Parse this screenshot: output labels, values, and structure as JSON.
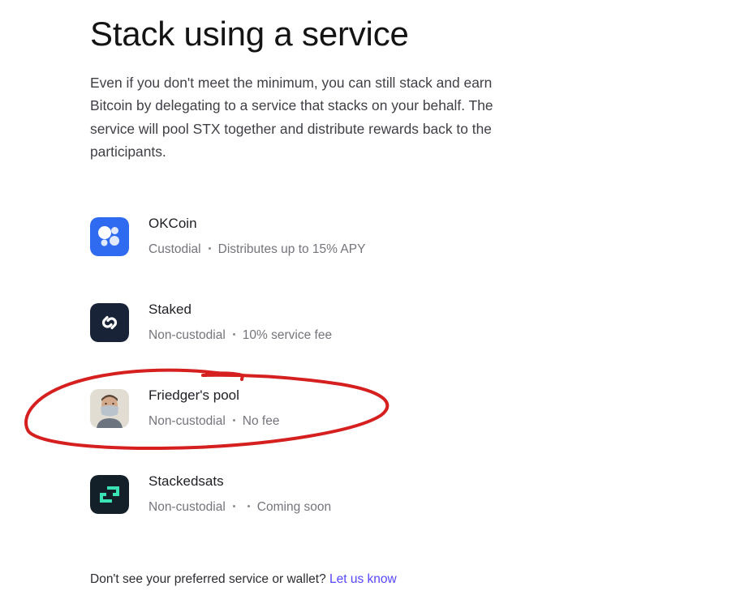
{
  "page": {
    "title": "Stack using a service",
    "description": "Even if you don't meet the minimum, you can still stack and earn Bitcoin by delegating to a service that stacks on your behalf. The service will pool STX together and distribute rewards back to the participants."
  },
  "services": [
    {
      "name": "OKCoin",
      "icon": "okcoin-logo",
      "custody": "Custodial",
      "detail": "Distributes up to 15% APY",
      "accent": "#2f6bf1"
    },
    {
      "name": "Staked",
      "icon": "staked-logo",
      "custody": "Non-custodial",
      "detail": "10% service fee",
      "accent": "#182338"
    },
    {
      "name": "Friedger's pool",
      "icon": "friedger-avatar",
      "custody": "Non-custodial",
      "detail": "No fee",
      "accent": "#d8d2c8"
    },
    {
      "name": "Stackedsats",
      "icon": "stackedsats-logo",
      "custody": "Non-custodial",
      "detail": "",
      "extra": "Coming soon",
      "accent": "#13202a"
    }
  ],
  "footer": {
    "prompt": "Don't see your preferred service or wallet?",
    "link_label": "Let us know",
    "link_color": "#5546ff"
  },
  "annotation": {
    "color": "#d61f1f"
  }
}
